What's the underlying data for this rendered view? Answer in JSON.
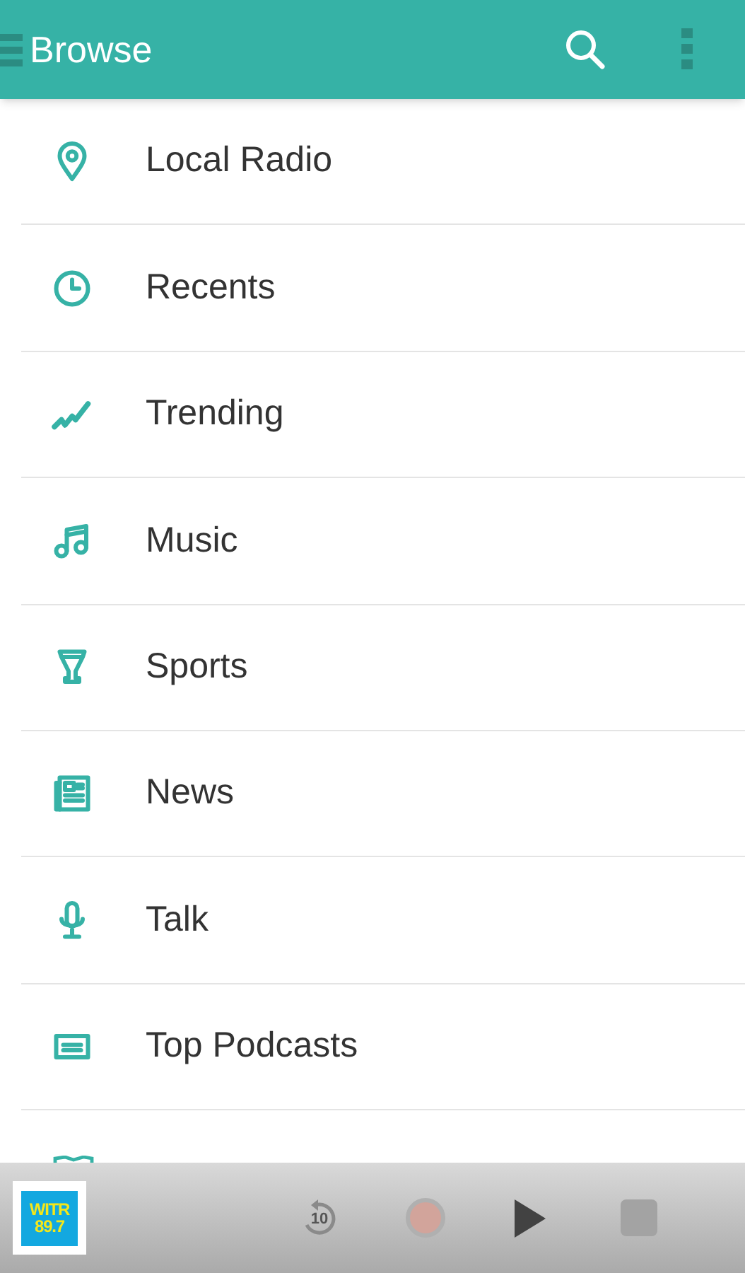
{
  "app_bar": {
    "title": "Browse"
  },
  "items": [
    {
      "label": "Local Radio"
    },
    {
      "label": "Recents"
    },
    {
      "label": "Trending"
    },
    {
      "label": "Music"
    },
    {
      "label": "Sports"
    },
    {
      "label": "News"
    },
    {
      "label": "Talk"
    },
    {
      "label": "Top Podcasts"
    }
  ],
  "player": {
    "logo_line_1": "WITR",
    "logo_line_2": "89.7",
    "rewind_label": "10"
  }
}
